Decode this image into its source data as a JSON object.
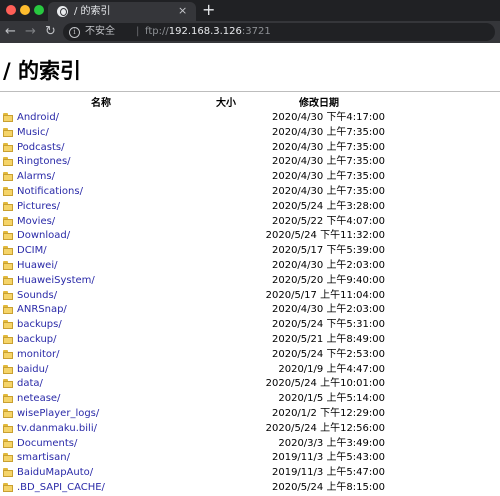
{
  "browser": {
    "tab_title": "/ 的索引",
    "tab_close": "×",
    "new_tab": "+",
    "security_label": "不安全",
    "url": {
      "scheme": "ftp://",
      "host": "192.168.3.126",
      "port": ":3721"
    },
    "icons": {
      "back": "arrow-left-icon",
      "forward": "arrow-right-icon",
      "reload": "reload-icon",
      "info": "info-icon",
      "favicon": "globe-icon"
    }
  },
  "page": {
    "title": "/ 的索引",
    "columns": {
      "name": "名称",
      "size": "大小",
      "modified": "修改日期"
    },
    "entries": [
      {
        "name": "Android/",
        "date": "2020/4/30 下午4:17:00"
      },
      {
        "name": "Music/",
        "date": "2020/4/30 上午7:35:00"
      },
      {
        "name": "Podcasts/",
        "date": "2020/4/30 上午7:35:00"
      },
      {
        "name": "Ringtones/",
        "date": "2020/4/30 上午7:35:00"
      },
      {
        "name": "Alarms/",
        "date": "2020/4/30 上午7:35:00"
      },
      {
        "name": "Notifications/",
        "date": "2020/4/30 上午7:35:00"
      },
      {
        "name": "Pictures/",
        "date": "2020/5/24 上午3:28:00"
      },
      {
        "name": "Movies/",
        "date": "2020/5/22 下午4:07:00"
      },
      {
        "name": "Download/",
        "date": "2020/5/24 下午11:32:00"
      },
      {
        "name": "DCIM/",
        "date": "2020/5/17 下午5:39:00"
      },
      {
        "name": "Huawei/",
        "date": "2020/4/30 上午2:03:00"
      },
      {
        "name": "HuaweiSystem/",
        "date": "2020/5/20 上午9:40:00"
      },
      {
        "name": "Sounds/",
        "date": "2020/5/17 上午11:04:00"
      },
      {
        "name": "ANRSnap/",
        "date": "2020/4/30 上午2:03:00"
      },
      {
        "name": "backups/",
        "date": "2020/5/24 下午5:31:00"
      },
      {
        "name": "backup/",
        "date": "2020/5/21 上午8:49:00"
      },
      {
        "name": "monitor/",
        "date": "2020/5/24 下午2:53:00"
      },
      {
        "name": "baidu/",
        "date": "2020/1/9 上午4:47:00"
      },
      {
        "name": "data/",
        "date": "2020/5/24 上午10:01:00"
      },
      {
        "name": "netease/",
        "date": "2020/1/5 上午5:14:00"
      },
      {
        "name": "wisePlayer_logs/",
        "date": "2020/1/2 下午12:29:00"
      },
      {
        "name": "tv.danmaku.bili/",
        "date": "2020/5/24 上午12:56:00"
      },
      {
        "name": "Documents/",
        "date": "2020/3/3 上午3:49:00"
      },
      {
        "name": "smartisan/",
        "date": "2019/11/3 上午5:43:00"
      },
      {
        "name": "BaiduMapAuto/",
        "date": "2019/11/3 上午5:47:00"
      },
      {
        "name": ".BD_SAPI_CACHE/",
        "date": "2020/5/24 上午8:15:00"
      }
    ]
  },
  "colors": {
    "chrome_dark": "#202124",
    "chrome_tab": "#35363a",
    "link": "#2a2aa8",
    "folder": "#f5d469"
  }
}
